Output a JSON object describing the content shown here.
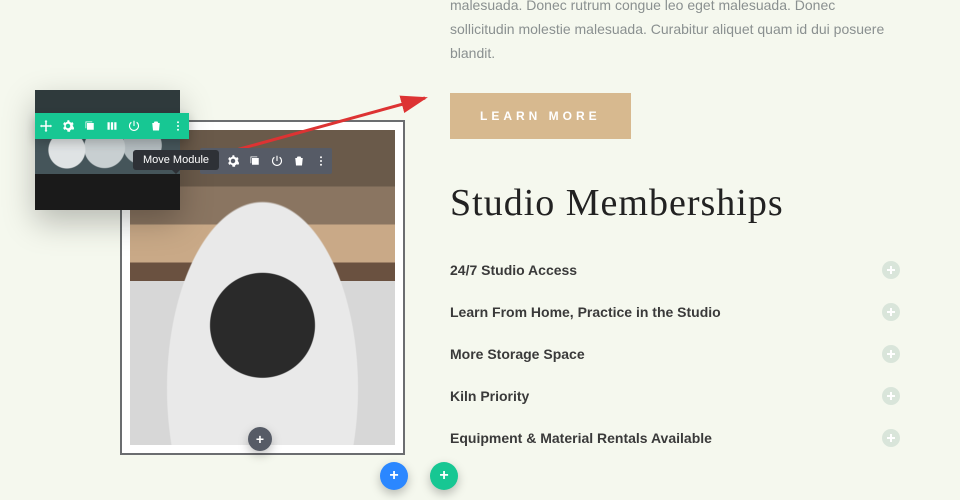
{
  "intro": {
    "line1": "malesuada. Donec rutrum congue leo eget malesuada. Donec sollicitudin",
    "line2": "molestie malesuada. Curabitur aliquet quam id dui posuere blandit."
  },
  "cta_label": "LEARN MORE",
  "heading": "Studio Memberships",
  "accordion": [
    {
      "label": "24/7 Studio Access"
    },
    {
      "label": "Learn From Home, Practice in the Studio"
    },
    {
      "label": "More Storage Space"
    },
    {
      "label": "Kiln Priority"
    },
    {
      "label": "Equipment & Material Rentals Available"
    }
  ],
  "tooltip": "Move Module",
  "toolbar_icons": [
    "move",
    "gear",
    "duplicate",
    "columns",
    "power",
    "trash",
    "more"
  ],
  "colors": {
    "teal": "#17c793",
    "tan": "#d7b98f",
    "blue": "#2b87ff",
    "bg": "#f5f8ee"
  }
}
